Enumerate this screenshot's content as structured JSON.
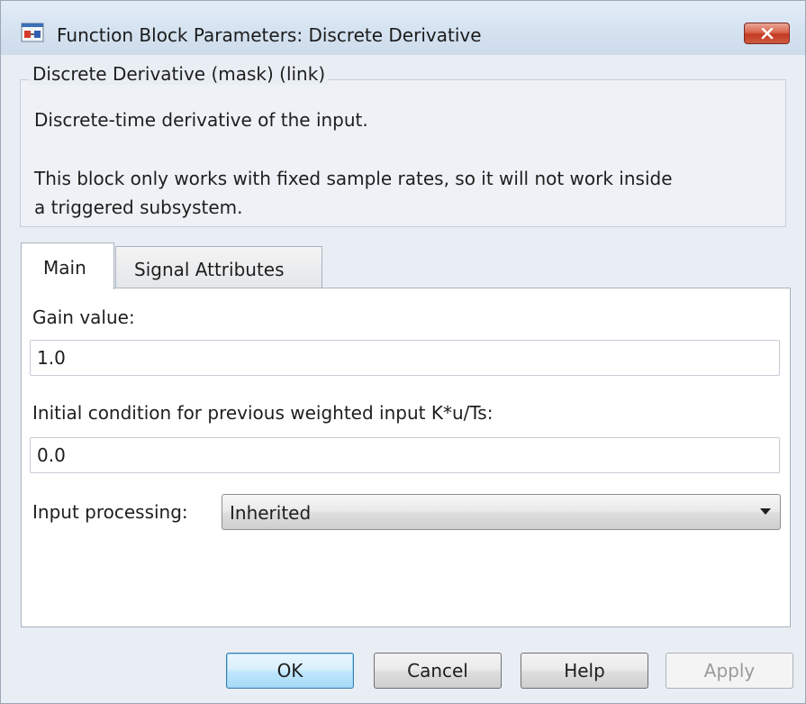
{
  "window": {
    "title": "Function Block Parameters: Discrete Derivative"
  },
  "description": {
    "group_title": "Discrete Derivative (mask) (link)",
    "lines": [
      "Discrete-time derivative of the input.",
      "This block only works with fixed sample rates, so it will not work inside",
      "a triggered subsystem."
    ]
  },
  "tabs": [
    {
      "label": "Main",
      "selected": true
    },
    {
      "label": "Signal Attributes",
      "selected": false
    }
  ],
  "main": {
    "gain_label": "Gain value:",
    "gain_value": "1.0",
    "ic_label": "Initial condition for previous weighted input K*u/Ts:",
    "ic_value": "0.0",
    "input_processing_label": "Input processing:",
    "input_processing_value": "Inherited"
  },
  "buttons": {
    "ok": "OK",
    "cancel": "Cancel",
    "help": "Help",
    "apply": "Apply",
    "apply_enabled": false
  },
  "icons": {
    "app": "simulink-block-icon",
    "close": "close-icon",
    "dropdown": "chevron-down-icon"
  },
  "colors": {
    "titlebar": "#d6e3f1",
    "close_button": "#c94a33",
    "ok_button": "#bee6fd",
    "window_bg": "#e9eef5"
  }
}
